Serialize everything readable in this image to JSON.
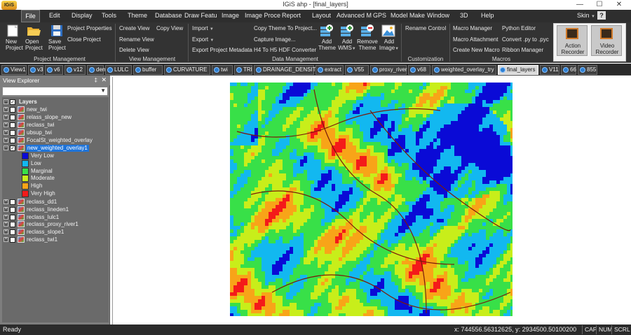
{
  "app": {
    "title": "IGiS ahp - [final_layers]",
    "logo_text": "IGiS",
    "skin_label": "Skin",
    "help_label": "?"
  },
  "window_controls": {
    "minimize": "—",
    "maximize": "☐",
    "close": "✕"
  },
  "menu": [
    "File",
    "Edit",
    "Display",
    "Tools",
    "Theme",
    "Database",
    "Draw Featu",
    "Image",
    "Image Proce",
    "Report",
    "Layout",
    "Advanced M",
    "GPS",
    "Model Make",
    "Window",
    "3D",
    "Help"
  ],
  "ribbon": {
    "project": {
      "new": [
        "New",
        "Project"
      ],
      "open": [
        "Open",
        "Project"
      ],
      "save": [
        "Save",
        "Project"
      ],
      "properties": "Project Properties",
      "close": "Close Project",
      "group": "Project Management"
    },
    "view": {
      "create": "Create View",
      "copy": "Copy View",
      "rename": "Rename View",
      "delete": "Delete View",
      "group": "View Management"
    },
    "data": {
      "import": "Import",
      "export": "Export",
      "export_meta": "Export Project Metadata",
      "copy_theme": "Copy Theme To Project...",
      "capture": "Capture Image...",
      "h4h5": "H4 To H5 HDF Converter",
      "add_theme": [
        "Add",
        "Theme"
      ],
      "add_wms": [
        "Add",
        "WMS"
      ],
      "remove_theme": [
        "Remove",
        "Theme"
      ],
      "add_image": [
        "Add",
        "Image"
      ],
      "group": "Data Management"
    },
    "custom": {
      "rename_control": "Rename Control",
      "group": "Customization"
    },
    "macros": {
      "manager": "Macro Manager",
      "attachment": "Macro Attachment",
      "create": "Create New Macro",
      "python": "Python Editor",
      "convert": "Convert .py to .pyc",
      "ribbon_manager": "Ribbon Manager",
      "group": "Macros"
    },
    "recorders": {
      "action": [
        "Action",
        "Recorder"
      ],
      "video": [
        "Video",
        "Recorder"
      ]
    }
  },
  "tabs": [
    "View1",
    "v3",
    "v6",
    "v12",
    "dem",
    "LULC",
    "buffer",
    "CURVATURE",
    "twi",
    "TRI",
    "DRAINAGE_DENSITY",
    "extract",
    "V55",
    "proxy_river",
    "v68",
    "weighted_overlay_try",
    "final_layers",
    "V11",
    "66",
    "855"
  ],
  "active_tab": "final_layers",
  "explorer": {
    "title": "View Explorer",
    "pin": "‡",
    "close": "✕",
    "root": "Layers",
    "layers_top": [
      "new_twi",
      "relass_slope_new",
      "reclass_twi",
      "ubsup_twi",
      "FocalSt_weighted_overlay"
    ],
    "selected_layer": "new_weighted_overlay1",
    "legend": [
      {
        "label": "Very Low",
        "color": "#0a0ad6"
      },
      {
        "label": "Low",
        "color": "#12b8f0"
      },
      {
        "label": "Marginal",
        "color": "#38e048"
      },
      {
        "label": "Moderate",
        "color": "#c8ee1a"
      },
      {
        "label": "High",
        "color": "#f8a418"
      },
      {
        "label": "Very High",
        "color": "#f41a1a"
      }
    ],
    "layers_bottom": [
      "reclass_dd1",
      "reclass_lineden1",
      "reclass_lulc1",
      "reclass_proxy_river1",
      "reclass_slope1",
      "reclass_twi1"
    ]
  },
  "status": {
    "ready": "Ready",
    "coords": "x: 744556.56312625,  y: 2934500.50100200",
    "indicators": [
      "CAP",
      "NUM",
      "SCRL"
    ]
  }
}
